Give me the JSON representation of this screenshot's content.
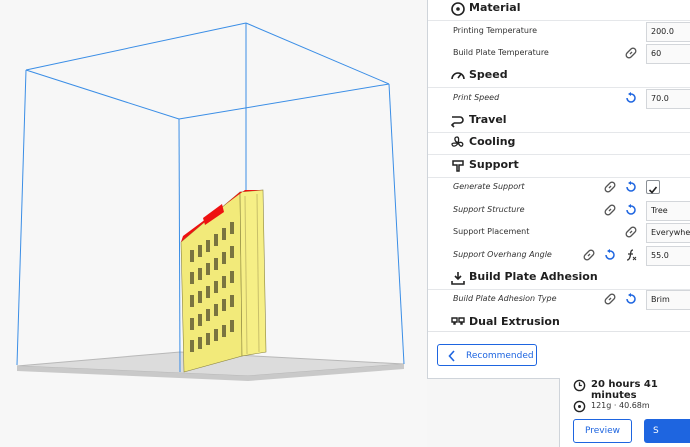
{
  "settings": {
    "material": {
      "title": "Material",
      "printing_temperature": {
        "label": "Printing Temperature",
        "value": "200.0"
      },
      "build_plate_temperature": {
        "label": "Build Plate Temperature",
        "value": "60"
      }
    },
    "speed": {
      "title": "Speed",
      "print_speed": {
        "label": "Print Speed",
        "value": "70.0"
      }
    },
    "travel": {
      "title": "Travel"
    },
    "cooling": {
      "title": "Cooling"
    },
    "support": {
      "title": "Support",
      "generate_support": {
        "label": "Generate Support",
        "checked": true
      },
      "support_structure": {
        "label": "Support Structure",
        "value": "Tree"
      },
      "support_placement": {
        "label": "Support Placement",
        "value": "Everywhere"
      },
      "support_overhang_angle": {
        "label": "Support Overhang Angle",
        "value": "55.0"
      }
    },
    "adhesion": {
      "title": "Build Plate Adhesion",
      "type": {
        "label": "Build Plate Adhesion Type",
        "value": "Brim"
      }
    },
    "dual_extrusion": {
      "title": "Dual Extrusion"
    },
    "recommended_label": "Recommended"
  },
  "estimate": {
    "print_time": "20 hours 41 minutes",
    "material_usage": "121g · 40.68m",
    "preview_label": "Preview",
    "slice_label": "S"
  },
  "colors": {
    "accent": "#1e65e0",
    "model_yellow": "#f2ea7a",
    "overhang_red": "#ee1111",
    "build_volume_line": "#3b8ee6"
  }
}
